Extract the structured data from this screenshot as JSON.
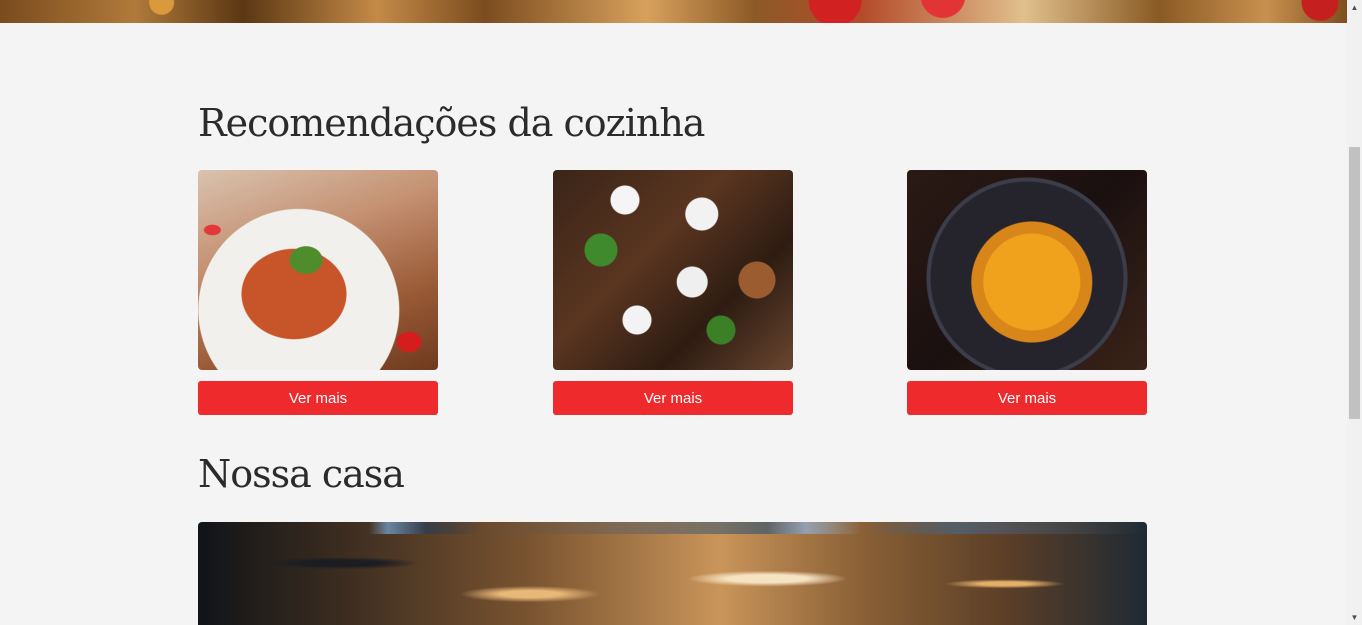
{
  "sections": {
    "recommendations_title": "Recomendações da cozinha",
    "house_title": "Nossa casa"
  },
  "recommendations": [
    {
      "image": "lasagna-photo",
      "button_label": "Ver mais"
    },
    {
      "image": "meat-dish-photo",
      "button_label": "Ver mais"
    },
    {
      "image": "pasta-bowl-photo",
      "button_label": "Ver mais"
    }
  ],
  "house": {
    "image": "restaurant-interior-photo"
  },
  "colors": {
    "accent": "#ee2a2d",
    "background": "#f4f4f4",
    "title": "#2b2b2b"
  },
  "icons": {
    "scroll_up": "chevron-up-icon",
    "scroll_down": "chevron-down-icon"
  }
}
